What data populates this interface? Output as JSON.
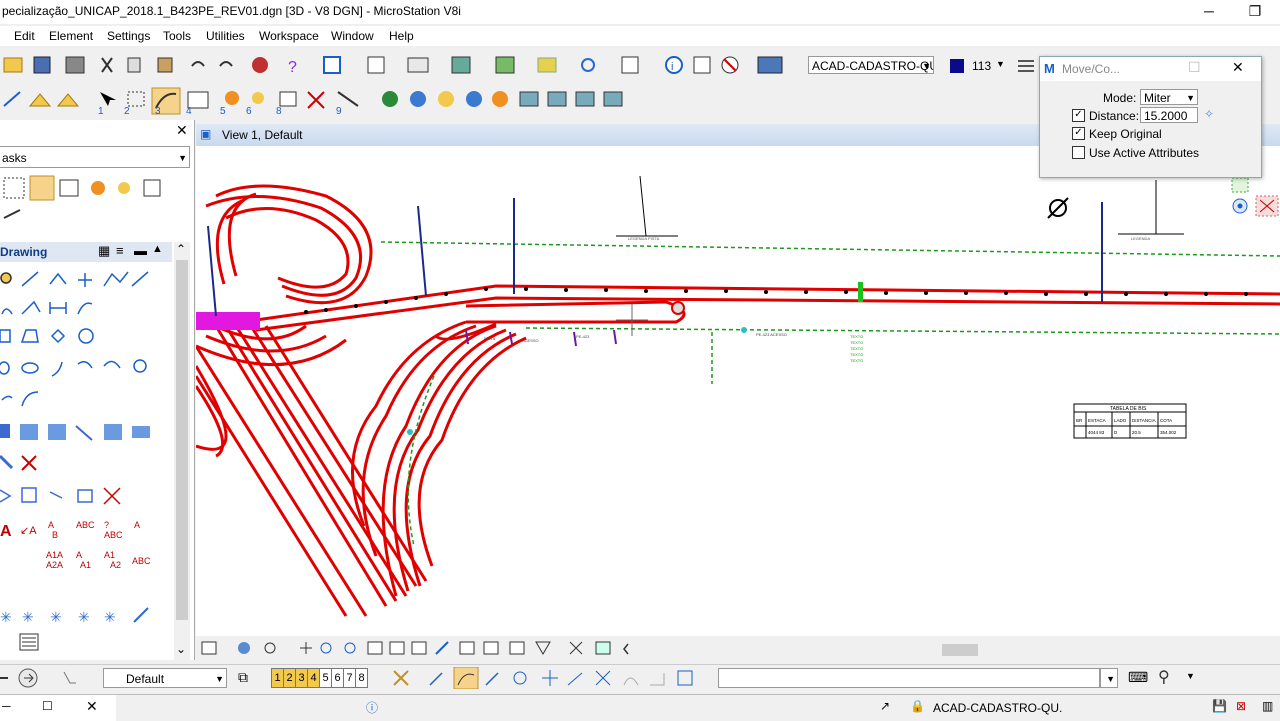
{
  "window": {
    "title": "pecialização_UNICAP_2018.1_B423PE_REV01.dgn [3D - V8 DGN] - MicroStation V8i",
    "minimize": "─",
    "restore": "❐"
  },
  "menu": [
    "Edit",
    "Element",
    "Settings",
    "Tools",
    "Utilities",
    "Workspace",
    "Window",
    "Help"
  ],
  "toolbar": {
    "level_combo": "ACAD-CADASTRO-QU",
    "color_value": "113",
    "color_swatch": "#0a0a8a"
  },
  "left_panel": {
    "tasks_label": "asks",
    "section_drawing": "Drawing",
    "close": "✕",
    "scroll_up": "⌃",
    "scroll_down": "⌄"
  },
  "view": {
    "title": "View 1, Default"
  },
  "dialog": {
    "title": "Move/Co...",
    "mode_label": "Mode:",
    "mode_value": "Miter",
    "distance_label": "Distance:",
    "distance_value": "15.2000",
    "distance_checked": true,
    "keep_original_label": "Keep Original",
    "keep_original_checked": true,
    "use_active_label": "Use Active Attributes",
    "use_active_checked": false
  },
  "bottom": {
    "view_group_combo": "Default",
    "view_numbers": [
      "1",
      "2",
      "3",
      "4",
      "5",
      "6",
      "7",
      "8"
    ],
    "prompt_text": ""
  },
  "status": {
    "level": "ACAD-CADASTRO-QU."
  },
  "drawing_texts": {
    "tabela_title": "TABELA DE BIS",
    "tabela_headers": [
      "BR",
      "ESTACA",
      "LADO",
      "DISTANCIA",
      "COTA"
    ],
    "tabela_row": [
      "",
      "4044 83",
      "D",
      "20.5",
      "354.002"
    ]
  }
}
